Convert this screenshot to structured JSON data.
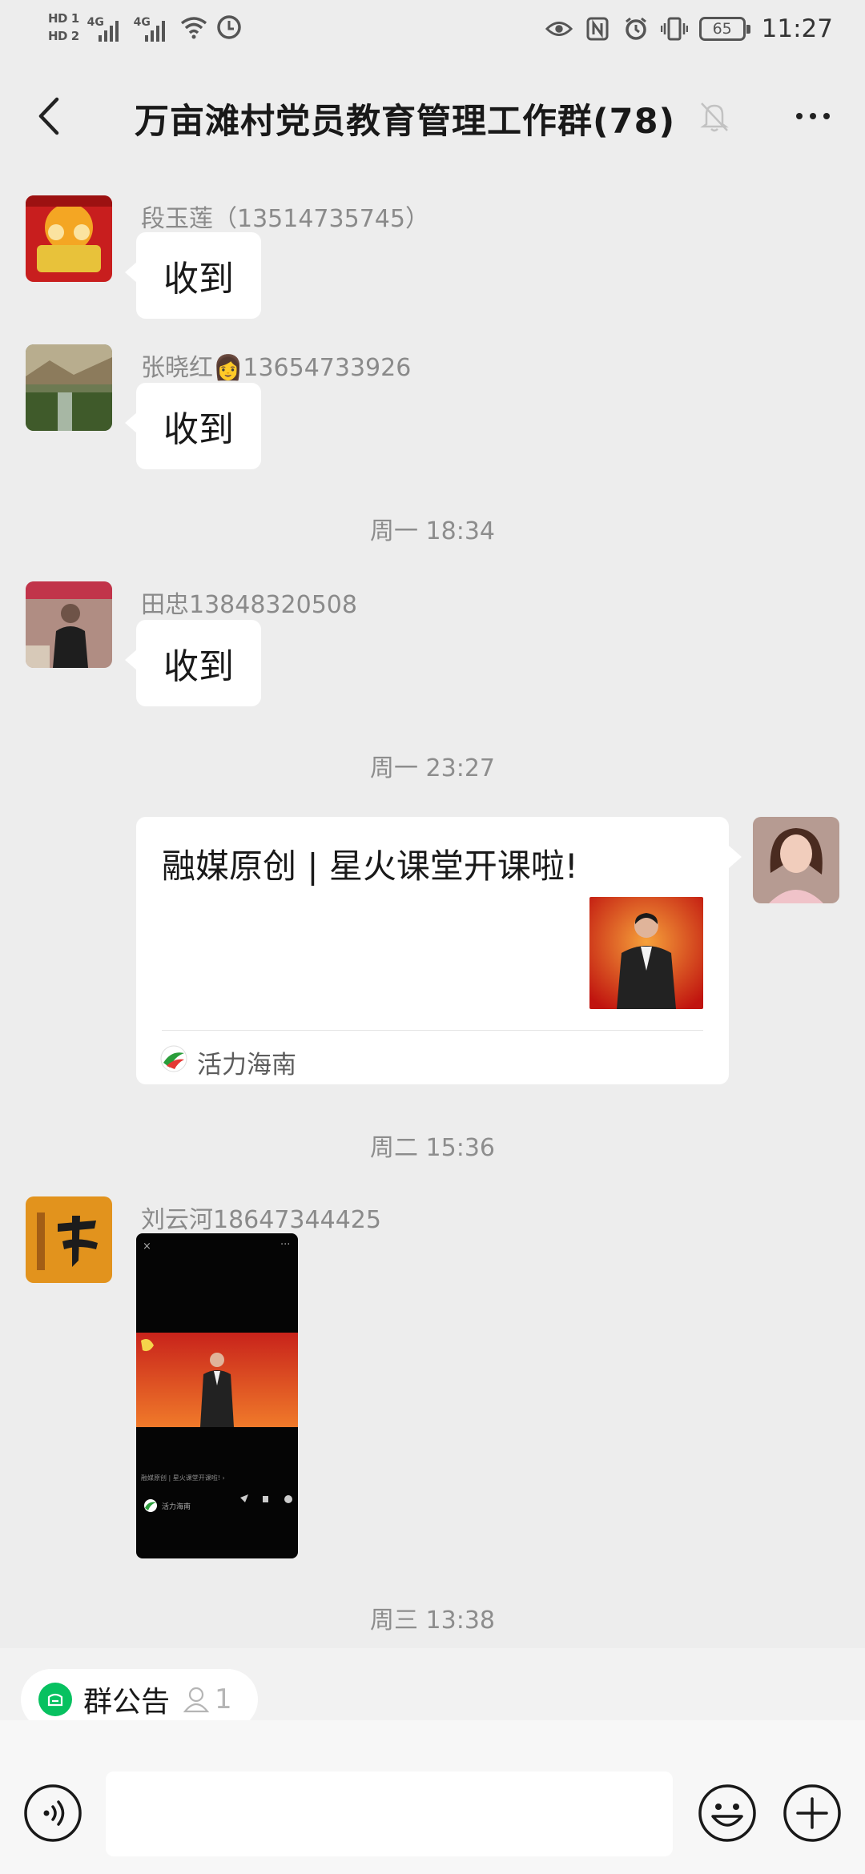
{
  "status_bar": {
    "hd1": "HD 1",
    "hd2": "HD 2",
    "net1": "4G",
    "net2": "4G",
    "battery": "65",
    "time": "11:27"
  },
  "top_bar": {
    "title": "万亩滩村党员教育管理工作群(78)",
    "back_icon": "chevron-left-icon",
    "mute_icon": "bell-off-icon",
    "more_icon": "more-dots-icon"
  },
  "messages": [
    {
      "sender": "段玉莲（13514735745）",
      "text": "收到"
    },
    {
      "sender": "张晓红👩13654733926",
      "text": "收到"
    },
    {
      "sender": "田忠13848320508",
      "text": "收到"
    },
    {
      "sender": "刘云河18647344425",
      "type": "video"
    }
  ],
  "timestamps": [
    "周一 18:34",
    "周一 23:27",
    "周二 15:36",
    "周三 13:38"
  ],
  "link_card": {
    "title": "融媒原创 | 星火课堂开课啦!",
    "source": "活力海南"
  },
  "video": {
    "caption": "融媒原创 | 星火课堂开课啦!",
    "source": "活力海南"
  },
  "notice": {
    "label": "群公告",
    "count": "1"
  },
  "input": {
    "placeholder": ""
  },
  "colors": {
    "background": "#ededed",
    "bubble": "#ffffff",
    "accent_green": "#07c160",
    "meta_text": "#8a8a8a"
  }
}
